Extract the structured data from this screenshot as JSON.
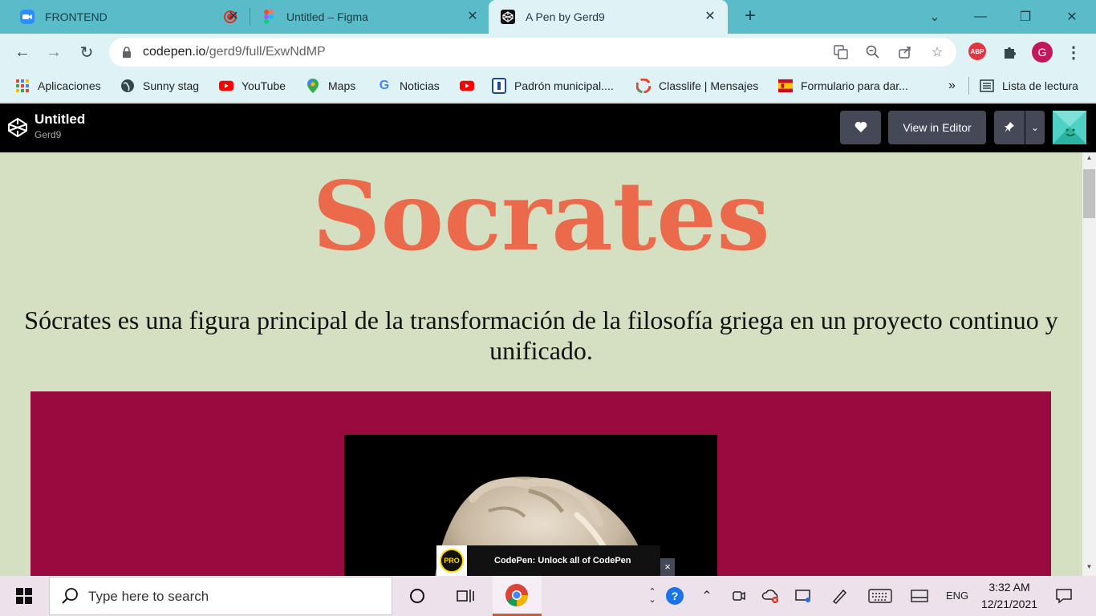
{
  "browser": {
    "tabs": [
      {
        "title": "FRONTEND",
        "icon": "zoom-icon",
        "active": false
      },
      {
        "title": "Untitled – Figma",
        "icon": "figma-icon",
        "active": false
      },
      {
        "title": "A Pen by Gerd9",
        "icon": "codepen-icon",
        "active": true
      }
    ],
    "url_host": "codepen.io",
    "url_path": "/gerd9/full/ExwNdMP",
    "bookmarks": [
      {
        "label": "Aplicaciones",
        "icon": "apps-grid-icon"
      },
      {
        "label": "Sunny stag",
        "icon": "globe-icon"
      },
      {
        "label": "YouTube",
        "icon": "youtube-icon"
      },
      {
        "label": "Maps",
        "icon": "maps-pin-icon"
      },
      {
        "label": "Noticias",
        "icon": "google-icon"
      },
      {
        "label": "",
        "icon": "youtube-icon"
      },
      {
        "label": "Padrón municipal....",
        "icon": "madrid-icon"
      },
      {
        "label": "Classlife | Mensajes",
        "icon": "classlife-icon"
      },
      {
        "label": "Formulario para dar...",
        "icon": "spain-flag-icon"
      }
    ],
    "overflow_label": "»",
    "reading_list_label": "Lista de lectura",
    "profile_initial": "G",
    "abp_label": "ABP"
  },
  "codepen": {
    "pen_title": "Untitled",
    "author": "Gerd9",
    "view_editor_label": "View in Editor"
  },
  "page": {
    "heading": "Socrates",
    "tagline": "Sócrates es una figura principal de la transformación de la filosofía griega en un proyecto continuo y unificado.",
    "colors": {
      "background": "#d4e0c1",
      "heading": "#ec6a4c",
      "panel": "#990a3e"
    }
  },
  "promo": {
    "badge": "PRO",
    "text": "CodePen: Unlock all of CodePen",
    "close": "×"
  },
  "taskbar": {
    "search_placeholder": "Type here to search",
    "language": "ENG",
    "time": "3:32 AM",
    "date": "12/21/2021"
  }
}
